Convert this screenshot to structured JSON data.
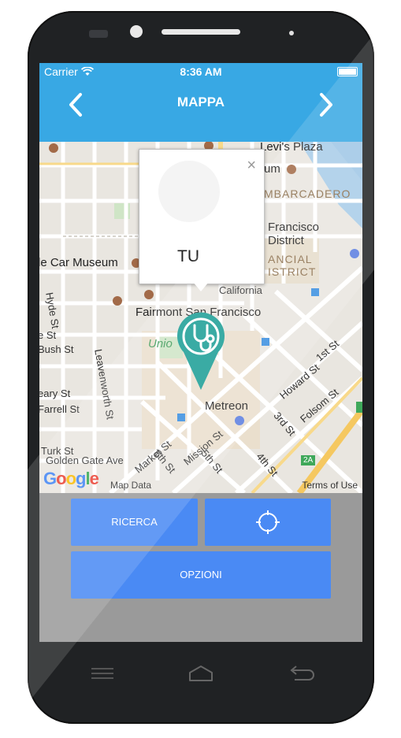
{
  "status_bar": {
    "carrier": "Carrier",
    "time": "8:36 AM"
  },
  "nav": {
    "title": "MAPPA",
    "prev_icon": "chevron-left-icon",
    "next_icon": "chevron-right-icon"
  },
  "map": {
    "labels": {
      "levis_plaza": "Levi's Plaza",
      "museum": "um",
      "embarcadero": "MBARCADERO",
      "francisco": "Francisco",
      "district": "District",
      "financial": "ANCIAL",
      "istrict": "ISTRICT",
      "cable_car_museum": "le Car Museum",
      "hyde_st": "Hyde St",
      "california": "California",
      "fairmont": "Fairmont San Francisco",
      "union": "Unio",
      "e_st": "e St",
      "bush_st": "Bush St",
      "leavenworth_st": "Leavenworth St",
      "first_st": "1st St",
      "howard_st": "Howard St",
      "folsom_st": "Folsom St",
      "third_st": "3rd St",
      "metreon": "Metreon",
      "geary_st": "eary St",
      "farrell_st": "Farrell St",
      "turk_st": "Turk St",
      "golden_gate_ave": "Golden Gate Ave",
      "market_st": "Market St",
      "sixth_st": "6th St",
      "mission_st": "Mission St",
      "fifth_st": "5th St",
      "fourth_st": "4th St",
      "highway": "2A"
    },
    "attribution": {
      "logo": "Google",
      "map_data": "Map Data",
      "terms": "Terms of Use"
    },
    "popup": {
      "label": "TU",
      "close": "×"
    },
    "marker_icon": "stethoscope-icon",
    "marker_color": "#1a9e95"
  },
  "actions": {
    "search_label": "RICERCA",
    "locate_icon": "crosshair-icon",
    "options_label": "OPZIONI"
  },
  "hardware_keys": {
    "menu_icon": "menu-icon",
    "home_icon": "home-icon",
    "back_icon": "back-icon"
  },
  "colors": {
    "accent": "#38a8e4",
    "button": "#4a8af4"
  }
}
